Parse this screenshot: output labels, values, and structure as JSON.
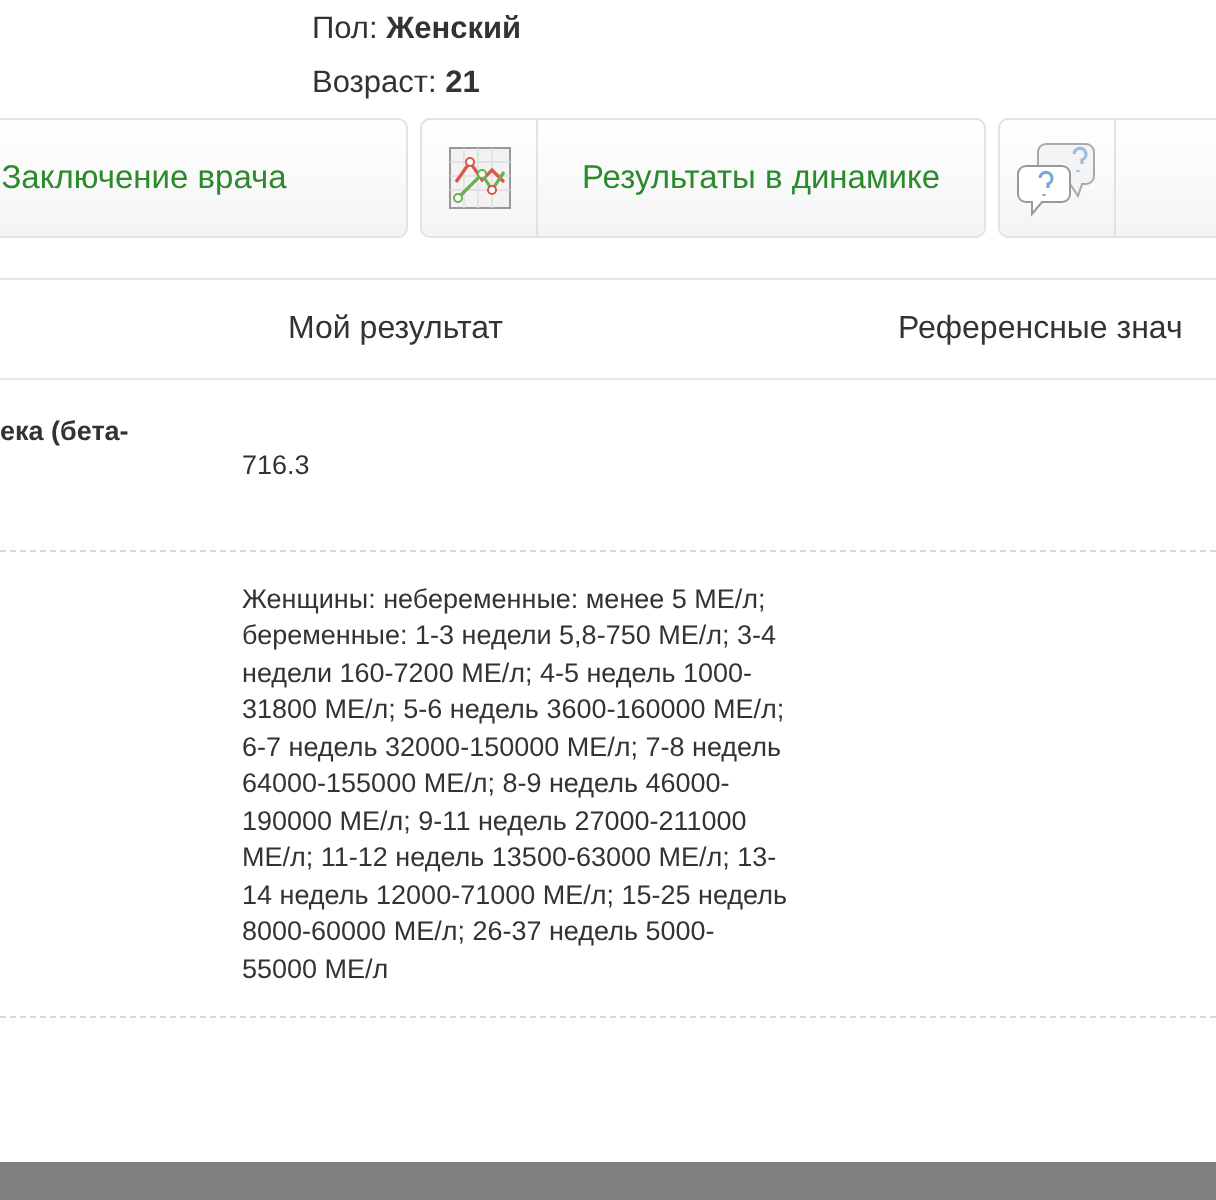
{
  "patient": {
    "fields": [
      {
        "label": "Пол:",
        "value": "Женский"
      },
      {
        "label": "Возраст:",
        "value": "21"
      }
    ]
  },
  "actions": [
    {
      "kind": "plain",
      "label": "Заключение врача"
    },
    {
      "kind": "chart",
      "label": "Результаты в динамике"
    },
    {
      "kind": "questions"
    }
  ],
  "table": {
    "columns": [
      "Мой результат",
      "Референсные знач"
    ],
    "rows": [
      {
        "label": "ека (бета-",
        "value": "716.3"
      },
      {
        "value": "Женщины: небеременные: менее 5 МЕ/л; беременные: 1-3 недели 5,8-750 МЕ/л; 3-4 недели 160-7200 МЕ/л; 4-5 недель 1000-31800 МЕ/л; 5-6 недель 3600-160000 МЕ/л; 6-7 недель 32000-150000 МЕ/л; 7-8 недель 64000-155000 МЕ/л; 8-9 недель 46000-190000 МЕ/л; 9-11 недель 27000-211000 МЕ/л; 11-12 недель 13500-63000 МЕ/л; 13-14 недель 12000-71000 МЕ/л; 15-25 недель 8000-60000 МЕ/л; 26-37 недель 5000-55000 МЕ/л"
      }
    ]
  }
}
